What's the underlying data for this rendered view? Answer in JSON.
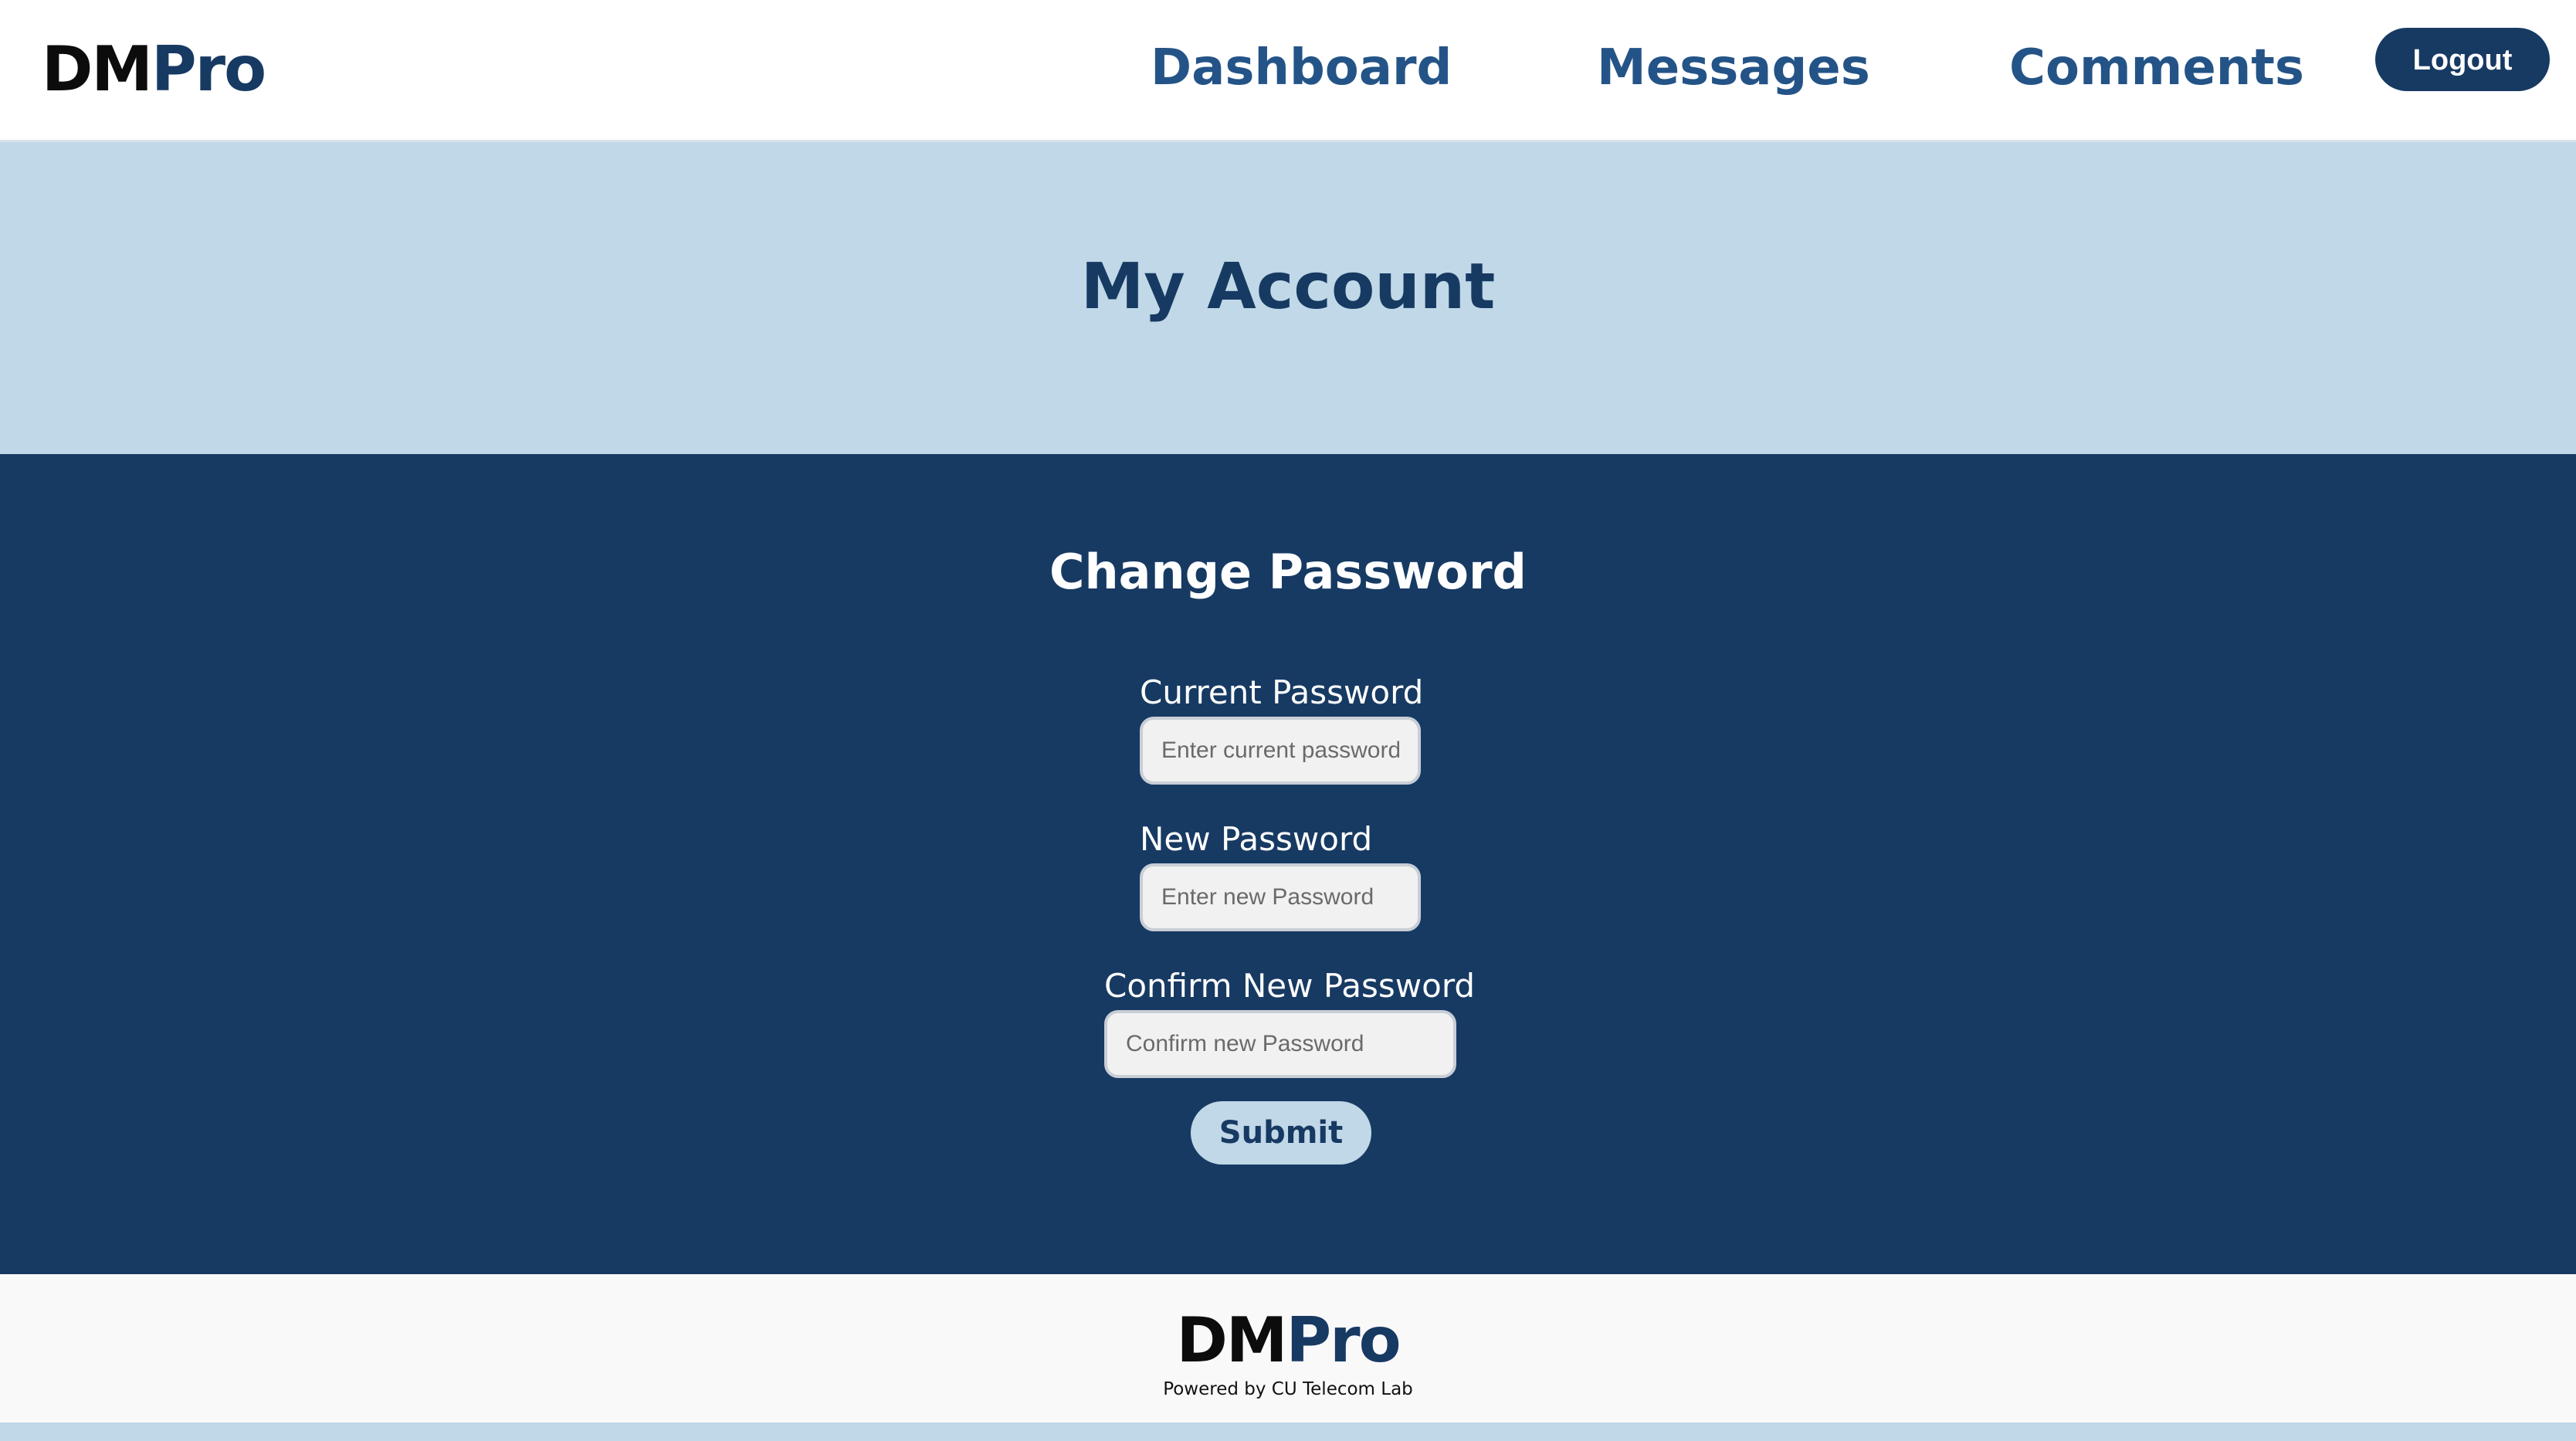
{
  "brand": {
    "logo_part1": "DM",
    "logo_part2": "Pro",
    "dark_color": "#0c0c0c",
    "accent_color": "#173a63"
  },
  "nav": {
    "items": [
      {
        "label": "Dashboard"
      },
      {
        "label": "Messages"
      },
      {
        "label": "Comments"
      }
    ],
    "logout_label": "Logout"
  },
  "page": {
    "title": "My Account"
  },
  "change_password": {
    "title": "Change Password",
    "current": {
      "label": "Current Password",
      "placeholder": "Enter current password",
      "value": ""
    },
    "new": {
      "label": "New Password",
      "placeholder": "Enter new Password",
      "value": ""
    },
    "confirm": {
      "label": "Confirm New Password",
      "placeholder": "Confirm new Password",
      "value": ""
    },
    "submit_label": "Submit"
  },
  "footer": {
    "logo_part1": "DM",
    "logo_part2": "Pro",
    "note": "Powered by CU Telecom Lab"
  },
  "colors": {
    "header_bg": "#ffffff",
    "band_bg": "#c0d8e7",
    "main_bg": "#173a63",
    "nav_link": "#245487",
    "footer_bg": "#faf9fa"
  }
}
